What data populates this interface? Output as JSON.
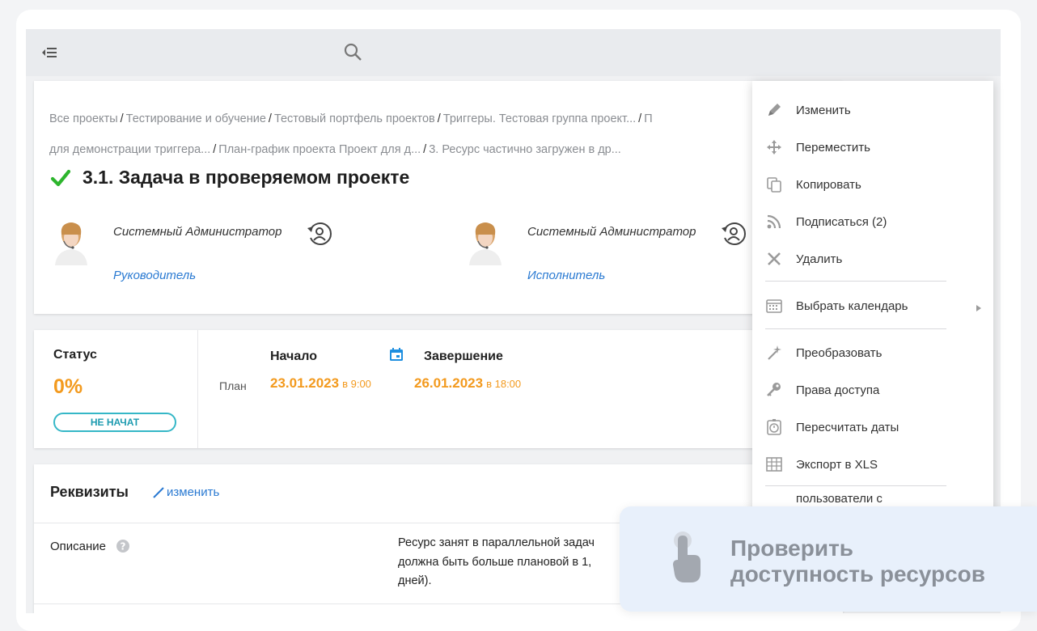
{
  "breadcrumb": {
    "line1": [
      "Все проекты",
      "Тестирование и обучение",
      "Тестовый портфель проектов",
      "Триггеры. Тестовая группа проект...",
      "П"
    ],
    "line2": [
      "для демонстрации триггера...",
      "План-график проекта Проект для д...",
      "3. Ресурс частично загружен в др..."
    ]
  },
  "task": {
    "title": "3.1. Задача в проверяемом проекте"
  },
  "people": [
    {
      "name": "Системный Администратор",
      "role": "Руководитель"
    },
    {
      "name": "Системный Администратор",
      "role": "Исполнитель"
    }
  ],
  "status": {
    "label": "Статус",
    "percent": "0%",
    "badge": "НЕ НАЧАТ"
  },
  "dates": {
    "start_header": "Начало",
    "end_header": "Завершение",
    "plan_label": "План",
    "start_date": "23.01.2023",
    "start_time": "в 9:00",
    "end_date": "26.01.2023",
    "end_time": "в 18:00"
  },
  "props": {
    "title": "Реквизиты",
    "edit_label": "изменить",
    "desc_label": "Описание",
    "desc_lines": [
      "Ресурс занят в параллельной задач",
      "должна быть больше плановой в 1,",
      "дней)."
    ]
  },
  "menu": {
    "items": [
      {
        "label": "Изменить",
        "icon": "pencil-icon"
      },
      {
        "label": "Переместить",
        "icon": "move-icon"
      },
      {
        "label": "Копировать",
        "icon": "copy-icon"
      },
      {
        "label": "Подписаться (2)",
        "icon": "rss-icon"
      },
      {
        "label": "Удалить",
        "icon": "close-icon"
      },
      {
        "label": "Выбрать календарь",
        "icon": "calendar-icon"
      },
      {
        "label": "Преобразовать",
        "icon": "magic-wand-icon"
      },
      {
        "label": "Права доступа",
        "icon": "key-icon"
      },
      {
        "label": "Пересчитать даты",
        "icon": "timer-icon"
      },
      {
        "label": "Экспорт в XLS",
        "icon": "table-icon"
      }
    ],
    "partial_item": "пользователи с"
  },
  "tooltip": {
    "line1": "Проверить",
    "line2": "доступность ресурсов"
  },
  "colors": {
    "accent_orange": "#f39a1e",
    "link_blue": "#2a7ad2",
    "badge_teal": "#35b7c7",
    "check_green": "#2db52d",
    "more_button_blue": "#1f73d6"
  }
}
